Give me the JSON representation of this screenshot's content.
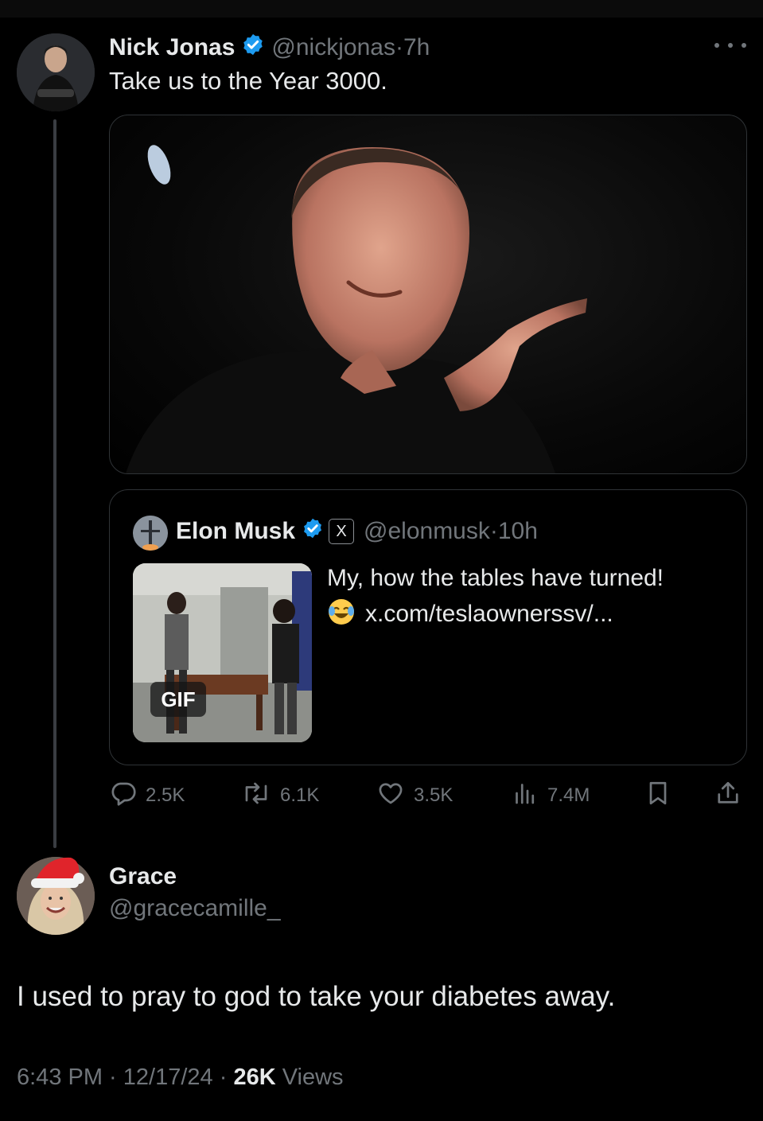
{
  "main_tweet": {
    "author_name": "Nick Jonas",
    "handle": "@nickjonas",
    "separator": " · ",
    "time": "7h",
    "text": "Take us to the Year 3000."
  },
  "quoted_tweet": {
    "author_name": "Elon Musk",
    "x_badge": "X",
    "handle": "@elonmusk",
    "separator": " · ",
    "time": "10h",
    "text_line1": "My, how the tables have turned!",
    "text_line2": "x.com/teslaownerssv/...",
    "gif_badge": "GIF"
  },
  "actions": {
    "replies": "2.5K",
    "reposts": "6.1K",
    "likes": "3.5K",
    "views": "7.4M"
  },
  "reply": {
    "author_name": "Grace",
    "handle": "@gracecamille_",
    "text": "I used to pray to god to take your diabetes away.",
    "time": "6:43 PM",
    "date": "12/17/24",
    "separator": " · ",
    "views_count": "26K",
    "views_label": " Views"
  },
  "icons": {
    "verified": "verified-badge-icon",
    "more": "more-options-icon",
    "reply": "reply-icon",
    "repost": "repost-icon",
    "like": "heart-icon",
    "views": "analytics-icon",
    "bookmark": "bookmark-icon",
    "share": "share-icon"
  },
  "colors": {
    "background": "#000000",
    "text_primary": "#e7e9ea",
    "text_secondary": "#71767b",
    "border": "#2f3336",
    "verified_blue": "#1d9bf0"
  }
}
